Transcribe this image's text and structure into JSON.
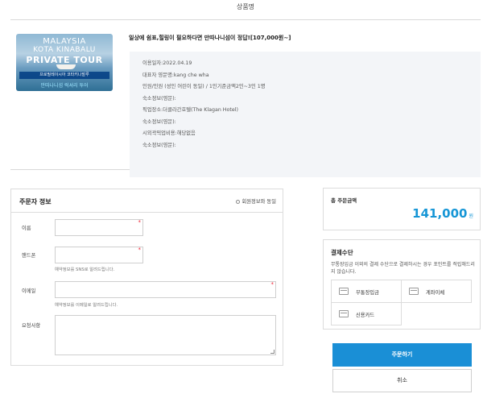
{
  "header": {
    "title": "상품명"
  },
  "product": {
    "thumbnail": {
      "line1": "MALAYSIA",
      "line2": "KOTA KINABALU",
      "line3": "PRIVATE TOUR",
      "banner": "프로필레이시아 코타키나발루",
      "bottom": "만따나니섬 럭셔리 투어"
    },
    "title": "일상에 쉼표,힐링이 필요하다면 만따나니섬이 정답![107,000원~]",
    "info": [
      "이용일자:2022.04.19",
      "대표자 영문명:kang che wha",
      "인원/인원 (성인 어린이 동일) / 1인기준금액2인~3인 1명",
      "숙소정보(영문):",
      "픽업장소:더클라간호텔(The Klagan Hotel)",
      "숙소정보(영문):",
      "시외곽픽업비용:해당없음",
      "숙소정보(영문):"
    ]
  },
  "order_form": {
    "title": "주문자 정보",
    "same_as_member": "회원정보와 동일",
    "fields": {
      "name_label": "이름",
      "phone_label": "핸드폰",
      "phone_note": "예약정보를 SNS로 알려드립니다.",
      "email_label": "이메일",
      "email_note": "예약정보를 이메일로 알려드립니다.",
      "request_label": "요청사항"
    },
    "required_mark": "*"
  },
  "total": {
    "label": "총 주문금액",
    "amount": "141,000",
    "unit": "원"
  },
  "payment": {
    "title": "결제수단",
    "description": "무통장입금 이외의 결제 수단으로 결제하시는 경우 포인트를 적립해드리지 않습니다.",
    "options": [
      "무통장입금",
      "계좌이체",
      "신용카드"
    ]
  },
  "buttons": {
    "order": "주문하기",
    "cancel": "취소"
  }
}
